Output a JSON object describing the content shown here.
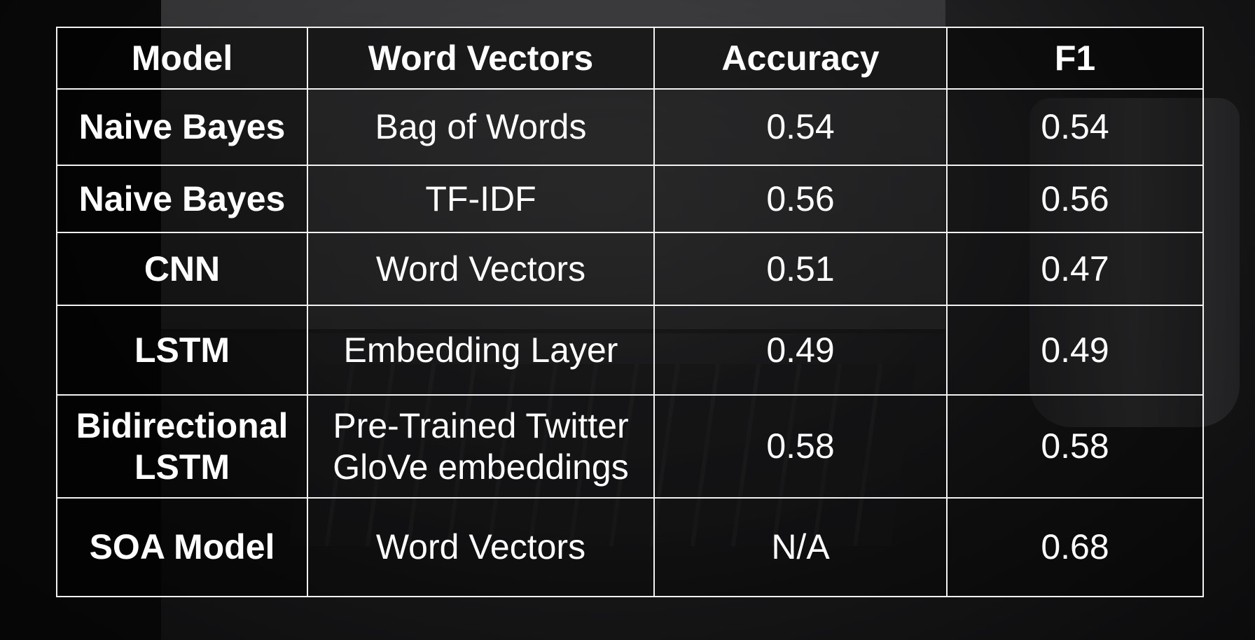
{
  "table": {
    "headers": [
      "Model",
      "Word Vectors",
      "Accuracy",
      "F1"
    ],
    "rows": [
      {
        "model": "Naive Bayes",
        "vectors": "Bag of Words",
        "accuracy": "0.54",
        "f1": "0.54"
      },
      {
        "model": "Naive Bayes",
        "vectors": "TF-IDF",
        "accuracy": "0.56",
        "f1": "0.56"
      },
      {
        "model": "CNN",
        "vectors": "Word Vectors",
        "accuracy": "0.51",
        "f1": "0.47"
      },
      {
        "model": "LSTM",
        "vectors": "Embedding Layer",
        "accuracy": "0.49",
        "f1": "0.49"
      },
      {
        "model": "Bidirectional LSTM",
        "vectors": "Pre-Trained Twitter GloVe embeddings",
        "accuracy": "0.58",
        "f1": "0.58"
      },
      {
        "model": "SOA Model",
        "vectors": "Word Vectors",
        "accuracy": "N/A",
        "f1": "0.68"
      }
    ]
  }
}
